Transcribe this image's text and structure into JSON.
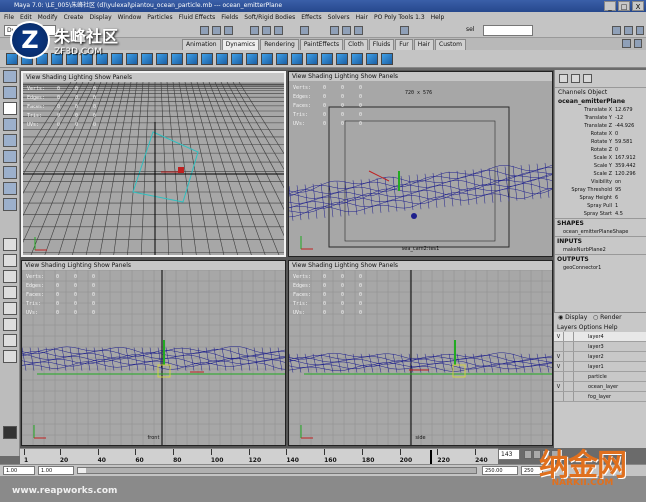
{
  "window": {
    "title": "Maya 7.0: \\LE_005\\朱峰社区 (d)\\yulexal\\piantou_ocean_particle.mb  ---  ocean_emitterPlane",
    "min": "_",
    "max": "□",
    "close": "X"
  },
  "menubar": [
    "File",
    "Edit",
    "Modify",
    "Create",
    "Display",
    "Window",
    "Particles",
    "Fluid Effects",
    "Fields",
    "Soft/Rigid Bodies",
    "Effects",
    "Solvers",
    "Hair",
    "PO Poly Tools 1.3",
    "Help"
  ],
  "status_line": {
    "mode": "Dynamics",
    "search_label": "sel"
  },
  "shelf_tabs": [
    "Animation",
    "Dynamics",
    "Rendering",
    "PaintEffects",
    "Cloth",
    "Fluids",
    "Fur",
    "Hair",
    "Custom"
  ],
  "shelf_active_tab": "Dynamics",
  "viewport_menu": [
    "View",
    "Shading",
    "Lighting",
    "Show",
    "Panels"
  ],
  "hud_labels": [
    "Verts:",
    "Edges:",
    "Faces:",
    "Tris:",
    "UVs:"
  ],
  "hud_values": [
    "0",
    "0",
    "0",
    "0",
    "0"
  ],
  "viewports": [
    {
      "id": "top-left",
      "label": ""
    },
    {
      "id": "top-right",
      "label": "sea_cam2:tes1",
      "resolution": "720 x 576"
    },
    {
      "id": "bottom-left",
      "label": "front"
    },
    {
      "id": "bottom-right",
      "label": "side"
    }
  ],
  "channel_box": {
    "header": "Channels   Object",
    "object": "ocean_emitterPlane",
    "attributes": [
      {
        "name": "Translate X",
        "value": "12.679"
      },
      {
        "name": "Translate Y",
        "value": "-12"
      },
      {
        "name": "Translate Z",
        "value": "-44.926"
      },
      {
        "name": "Rotate X",
        "value": "0"
      },
      {
        "name": "Rotate Y",
        "value": "59.581"
      },
      {
        "name": "Rotate Z",
        "value": "0"
      },
      {
        "name": "Scale X",
        "value": "167.912"
      },
      {
        "name": "Scale Y",
        "value": "359.442"
      },
      {
        "name": "Scale Z",
        "value": "120.296"
      },
      {
        "name": "Visibility",
        "value": "on"
      },
      {
        "name": "Spray Threshold",
        "value": "95"
      },
      {
        "name": "Spray Height",
        "value": "6"
      },
      {
        "name": "Spray Pull",
        "value": "1"
      },
      {
        "name": "Spray Start",
        "value": "4.5"
      }
    ],
    "shapes_header": "SHAPES",
    "shape": "ocean_emitterPlaneShape",
    "inputs_header": "INPUTS",
    "input": "makeNurbPlane2",
    "outputs_header": "OUTPUTS",
    "output": "geoConnector1"
  },
  "layers": {
    "display": "Display",
    "render": "Render",
    "menu": "Layers   Options   Help",
    "items": [
      {
        "name": "layer4",
        "visible": "V",
        "selected": true
      },
      {
        "name": "layer3",
        "visible": "",
        "selected": false
      },
      {
        "name": "layer2",
        "visible": "V",
        "selected": false
      },
      {
        "name": "layer1",
        "visible": "V",
        "selected": false
      },
      {
        "name": "particle",
        "visible": "",
        "selected": false
      },
      {
        "name": "ocean_layer",
        "visible": "V",
        "selected": false
      },
      {
        "name": "fog_layer",
        "visible": "",
        "selected": false
      }
    ]
  },
  "timeline": {
    "ticks": [
      "1",
      "20",
      "40",
      "60",
      "80",
      "100",
      "120",
      "140",
      "160",
      "180",
      "200",
      "220",
      "240"
    ],
    "current_frame": "143"
  },
  "range": {
    "start": "1.00",
    "start_inner": "1.00",
    "end_inner": "250.00",
    "end": "250"
  },
  "watermarks": {
    "logo_mark": "Z",
    "logo_cn": "朱峰社区",
    "logo_en": "ZF3D.COM",
    "bottom_left": "www.reapworks.com",
    "bottom_right_cn": "纳金网",
    "bottom_right_en": "NARKII.COM"
  },
  "colors": {
    "wire_blue": "#1d1f8c",
    "grid": "#3c3c3c",
    "camera_green": "#22aa22",
    "accent_orange": "#e0701e"
  }
}
